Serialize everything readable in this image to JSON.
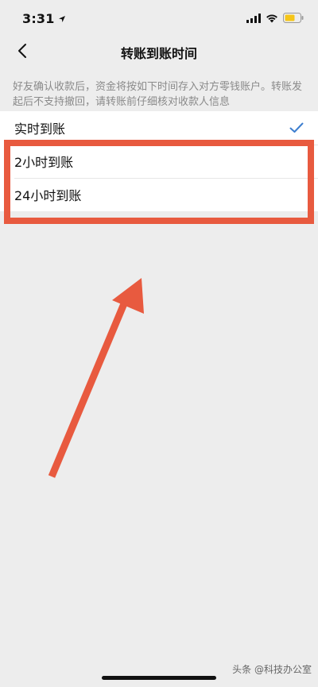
{
  "status_bar": {
    "time": "3:31",
    "icons": [
      "location-arrow-icon",
      "cellular-signal-icon",
      "wifi-icon",
      "battery-icon"
    ],
    "battery_color": "#f5c518"
  },
  "nav": {
    "title": "转账到账时间",
    "back_icon": "chevron-left-icon"
  },
  "description": "好友确认收款后，资金将按如下时间存入对方零钱账户。转账发起后不支持撤回，请转账前仔细核对收款人信息",
  "options": [
    {
      "label": "实时到账",
      "selected": true
    },
    {
      "label": "2小时到账",
      "selected": false
    },
    {
      "label": "24小时到账",
      "selected": false
    }
  ],
  "colors": {
    "accent_check": "#3d7ecf",
    "highlight": "#e85a3f",
    "background": "#ededed"
  },
  "watermark": "头条 @科技办公室"
}
